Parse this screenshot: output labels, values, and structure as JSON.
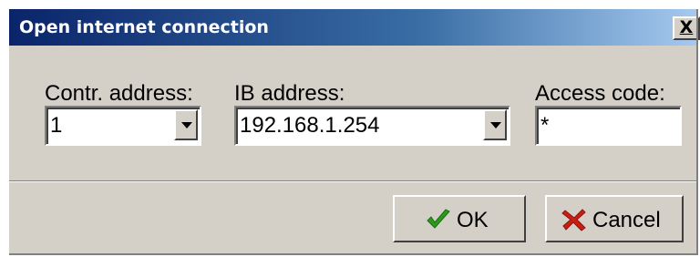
{
  "window": {
    "title": "Open internet connection",
    "close_label": "X"
  },
  "form": {
    "controller_address": {
      "label": "Contr. address:",
      "value": "1"
    },
    "ib_address": {
      "label": "IB address:",
      "value": "192.168.1.254"
    },
    "access_code": {
      "label": "Access code:",
      "value": "*"
    }
  },
  "buttons": {
    "ok": {
      "label": "OK",
      "icon": "checkmark-icon",
      "icon_color": "#2a9a1a"
    },
    "cancel": {
      "label": "Cancel",
      "icon": "x-mark-icon",
      "icon_color": "#c81e14"
    }
  },
  "colors": {
    "dialog_bg": "#d4d0c8",
    "titlebar_start": "#0a246a",
    "titlebar_end": "#a6caf0"
  }
}
